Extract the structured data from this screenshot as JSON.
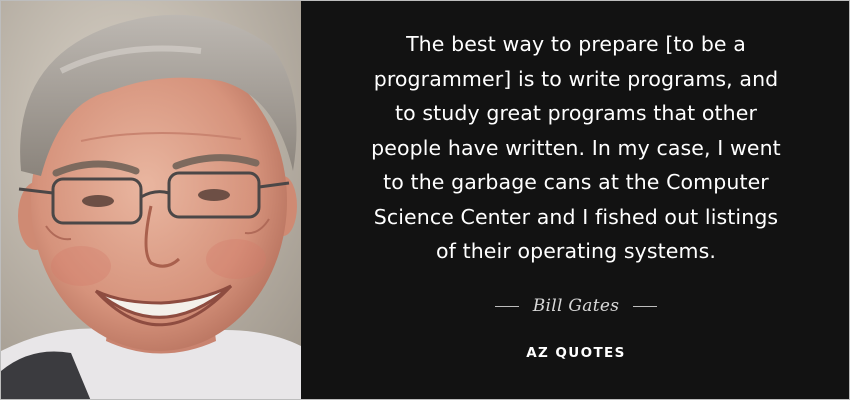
{
  "quote": {
    "lines": [
      "The best way to prepare [to be a",
      "programmer] is to write programs, and",
      "to study great programs that other",
      "people have written. In my case, I went",
      "to the garbage cans at the Computer",
      "Science Center and I fished out listings",
      "of their operating systems."
    ]
  },
  "author": "Bill Gates",
  "brand": "AZ QUOTES",
  "colors": {
    "panel_background": "#121212",
    "quote_text": "#ffffff",
    "author_text": "#d8d8d8"
  }
}
